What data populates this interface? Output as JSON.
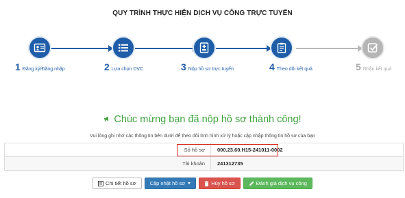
{
  "page_title": "QUY TRÌNH THỰC HIỆN DỊCH VỤ CÔNG TRỰC TUYẾN",
  "steps": [
    {
      "num": "1",
      "label": "Đăng ký/Đăng nhập",
      "icon": "id-card-icon",
      "status": "done"
    },
    {
      "num": "2",
      "label": "Lựa chọn DVC",
      "icon": "list-icon",
      "status": "done"
    },
    {
      "num": "3",
      "label": "Nộp hồ sơ trực tuyến",
      "icon": "medical-doc-icon",
      "status": "done"
    },
    {
      "num": "4",
      "label": "Theo dõi kết quả",
      "icon": "clipboard-icon",
      "status": "done"
    },
    {
      "num": "5",
      "label": "Nhận kết quả",
      "icon": "check-square-icon",
      "status": "inactive"
    }
  ],
  "success_message": "Chúc mừng bạn đã nộp hồ sơ thành công!",
  "note": "Vui lòng ghi nhớ các thông tin bên dưới để theo dõi tình hình xử lý hoặc cập nhập thông tin hồ sơ của bạn",
  "info": {
    "ho_so_label": "Số hồ sơ",
    "ho_so_value": "000.23.60.H15-241011-0002",
    "tai_khoan_label": "Tài khoản",
    "tai_khoan_value": "241312735"
  },
  "buttons": {
    "detail": "Chi tiết hồ sơ",
    "update": "Cập nhật hồ sơ",
    "cancel": "Hủy hồ sơ",
    "rate": "Đánh giá dịch vụ công"
  },
  "colors": {
    "primary": "#1f5da8",
    "inactive": "#b5b5b5",
    "success": "#3ea33e",
    "highlight": "#d9261c"
  }
}
